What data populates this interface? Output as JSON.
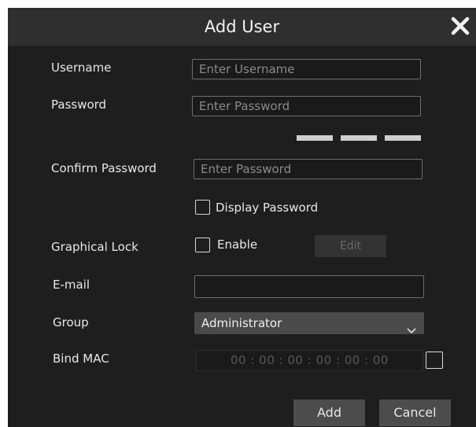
{
  "dialog": {
    "title": "Add User",
    "close_icon": "close-icon"
  },
  "form": {
    "username": {
      "label": "Username",
      "placeholder": "Enter Username",
      "value": ""
    },
    "password": {
      "label": "Password",
      "placeholder": "Enter Password",
      "value": ""
    },
    "confirm_password": {
      "label": "Confirm Password",
      "placeholder": "Enter Password",
      "value": ""
    },
    "display_password": {
      "label": "Display Password",
      "checked": false
    },
    "graphical_lock": {
      "label": "Graphical Lock",
      "enable_label": "Enable",
      "enabled": false,
      "edit_label": "Edit"
    },
    "email": {
      "label": "E-mail",
      "value": ""
    },
    "group": {
      "label": "Group",
      "value": "Administrator"
    },
    "bind_mac": {
      "label": "Bind MAC",
      "value": "00 : 00 : 00 : 00 : 00 : 00",
      "checked": false
    }
  },
  "footer": {
    "add_label": "Add",
    "cancel_label": "Cancel"
  },
  "colors": {
    "dialog_bg": "#1e1e1e",
    "titlebar_bg": "#2f2f2f",
    "button_bg": "#4c4c4c",
    "strength_bar": "#cfcfcf"
  }
}
